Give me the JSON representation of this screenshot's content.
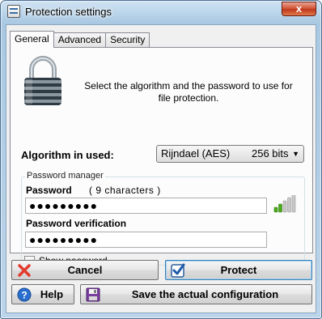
{
  "window": {
    "title": "Protection settings",
    "close_glyph": "x"
  },
  "tabs": [
    {
      "label": "General",
      "active": true
    },
    {
      "label": "Advanced",
      "active": false
    },
    {
      "label": "Security",
      "active": false
    }
  ],
  "general": {
    "intro_text": "Select the algorithm and the password to use for file protection.",
    "algorithm_label": "Algorithm in used:",
    "algorithm_name": "Rijndael (AES)",
    "algorithm_bits": "256 bits",
    "group_title": "Password manager",
    "password_label": "Password",
    "password_count": "( 9 characters )",
    "password_value": "●●●●●●●●●",
    "password_verification_label": "Password verification",
    "password_verification_value": "●●●●●●●●●",
    "show_password_label": "Show password",
    "show_password_checked": false,
    "strength_bars_filled": 2,
    "strength_bars_total": 5
  },
  "buttons": {
    "cancel": "Cancel",
    "protect": "Protect",
    "help": "Help",
    "save": "Save the actual configuration"
  },
  "colors": {
    "accent": "#3c7fb1",
    "strength_on": "#4caa1e",
    "strength_off": "#c8c8c8",
    "cancel_x": "#e23b2e",
    "help_blue": "#2a6fd0"
  },
  "icons": {
    "app": "app-settings-icon",
    "lock": "padlock-icon",
    "cancel": "red-x-icon",
    "protect": "checkmark-icon",
    "help": "help-icon",
    "save": "floppy-disk-icon"
  }
}
